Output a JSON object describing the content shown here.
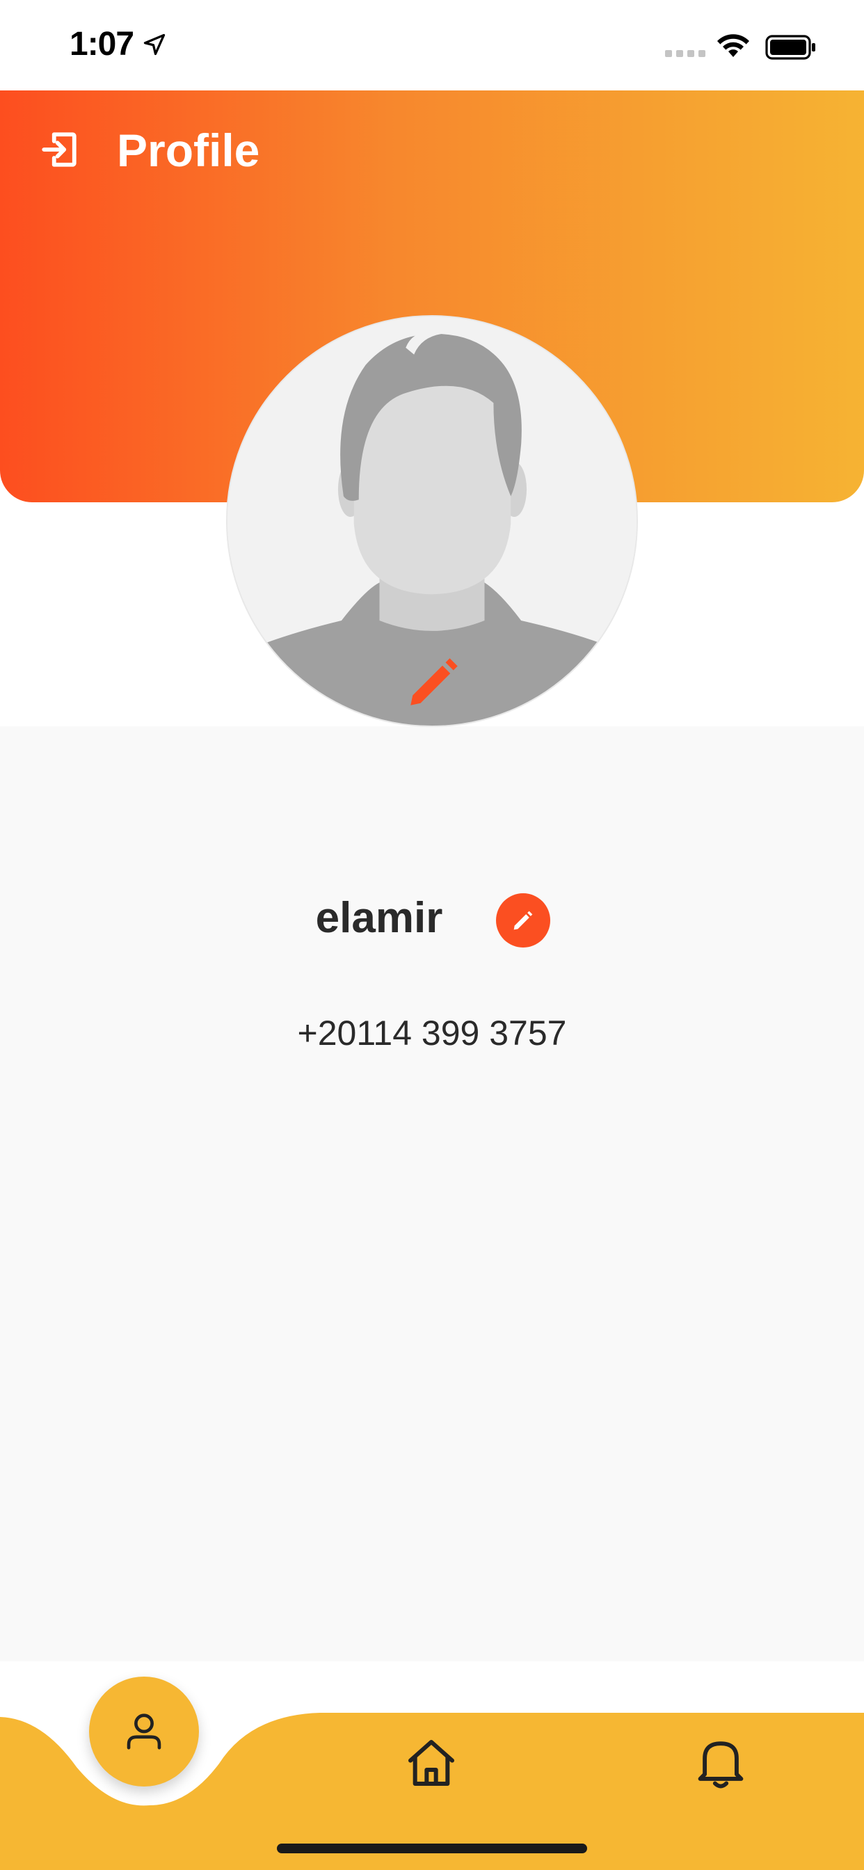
{
  "status_bar": {
    "time": "1:07"
  },
  "header": {
    "title": "Profile",
    "logout_icon": "logout-icon"
  },
  "profile": {
    "name": "elamir",
    "phone": "+20114 399 3757",
    "avatar_icon": "default-avatar",
    "avatar_edit_icon": "pencil-icon",
    "name_edit_icon": "pencil-icon"
  },
  "bottom_nav": {
    "items": [
      {
        "icon": "user-icon",
        "active": true
      },
      {
        "icon": "home-icon",
        "active": false
      },
      {
        "icon": "bell-icon",
        "active": false
      }
    ]
  },
  "colors": {
    "accent": "#fb4f21",
    "gradient_start": "#fd4e1f",
    "gradient_end": "#f6b333",
    "nav_background": "#f6b733",
    "content_background": "#f9f9f9"
  }
}
